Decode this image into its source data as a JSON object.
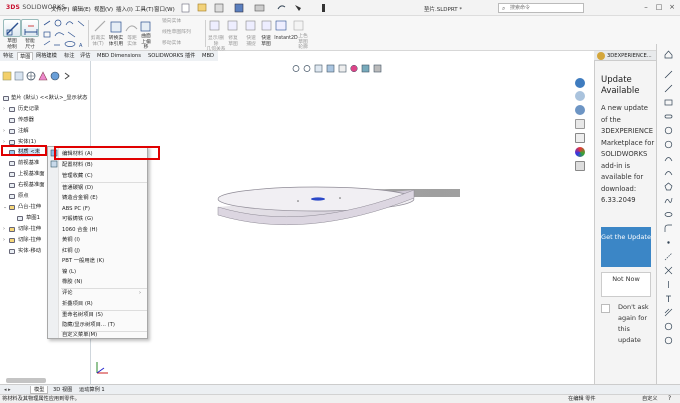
{
  "titlebar": {
    "logo_brand": "3DS",
    "logo_name": "SOLIDWORKS",
    "menus": [
      "文件(F)",
      "编辑(E)",
      "视图(V)",
      "插入(I)",
      "工具(T)",
      "窗口(W)"
    ],
    "doc_title": "垫片.SLDPRT *",
    "search_placeholder": "搜索命令",
    "search_icon": "magnifier-icon"
  },
  "ribbon": {
    "big_buttons": [
      {
        "label": "草图\n绘制"
      },
      {
        "label": "智能\n尺寸"
      }
    ],
    "gray_labels": [
      {
        "label": "剪裁实\n体(T)"
      },
      {
        "label": "转换实\n体引用"
      },
      {
        "label": "等距\n实体"
      },
      {
        "label": "曲面\n上偏\n移"
      }
    ],
    "mid_labels": [
      "镜向实体",
      "线性草图阵列",
      "移动实体"
    ],
    "right_labels": [
      "显示/删除\n几何关系",
      "修复\n草图",
      "快速\n捕捉",
      "快速\n草图",
      "Instant2D",
      "上色\n草图\n轮廓"
    ]
  },
  "command_tabs": [
    "特征",
    "草图",
    "网格建模",
    "标注",
    "评估",
    "MBD Dimensions",
    "SOLIDWORKS 插件",
    "MBD"
  ],
  "active_command_tab": 1,
  "tree": {
    "root": "垫片 (默认) <<默认>_显示状态",
    "items": [
      {
        "label": "历史记录"
      },
      {
        "label": "传感器"
      },
      {
        "label": "注解"
      },
      {
        "label": "实体(1)"
      },
      {
        "label": "材质 <未"
      },
      {
        "label": "前视基准"
      },
      {
        "label": "上视基准面"
      },
      {
        "label": "右视基准面"
      },
      {
        "label": "原点"
      },
      {
        "label": "凸台-拉伸"
      },
      {
        "label": "草图1"
      },
      {
        "label": "切除-拉伸"
      },
      {
        "label": "切除-拉伸"
      },
      {
        "label": "实体-移动"
      }
    ]
  },
  "context_menu": {
    "items": [
      {
        "label": "编辑材料 (A)"
      },
      {
        "label": "配置材料 (B)"
      },
      {
        "label": "管理收藏 (C)"
      },
      {
        "label": "普通碳钢 (D)"
      },
      {
        "label": "铸造合金钢 (E)"
      },
      {
        "label": "ABS PC (F)"
      },
      {
        "label": "可锻铸铁 (G)"
      },
      {
        "label": "1060 合金 (H)"
      },
      {
        "label": "黄铜 (I)"
      },
      {
        "label": "红铜 (J)"
      },
      {
        "label": "PBT 一般用途 (K)"
      },
      {
        "label": "镍 (L)"
      },
      {
        "label": "橡胶 (N)"
      },
      {
        "label": "评论",
        "submenu": true
      },
      {
        "label": "折叠项目 (R)"
      },
      {
        "label": "重命名树项目 (S)"
      },
      {
        "label": "隐藏/显示树项目... (T)"
      },
      {
        "label": "自定义菜单(M)"
      }
    ]
  },
  "right_panel": {
    "header": "3DEXPERIENCE...",
    "title": "Update Available",
    "body": "A new update of the 3DEXPERIENCE Marketplace for SOLIDWORKS add-in is available for download: 6.33.2049",
    "get_update_label": "Get the Update",
    "not_now_label": "Not Now",
    "dont_ask_label": "Don't ask again for this update"
  },
  "bottom_tabs": [
    "模型",
    "3D 视图",
    "运动算例 1"
  ],
  "active_bottom_tab": 0,
  "statusbar": {
    "left": "将材料及其物理属性应用到零件。",
    "mode": "在编辑 零件",
    "units": "自定义"
  },
  "colors": {
    "accent_red": "#e00000",
    "get_update_blue": "#3b86c6",
    "part_gray": "#e4e1e7"
  }
}
